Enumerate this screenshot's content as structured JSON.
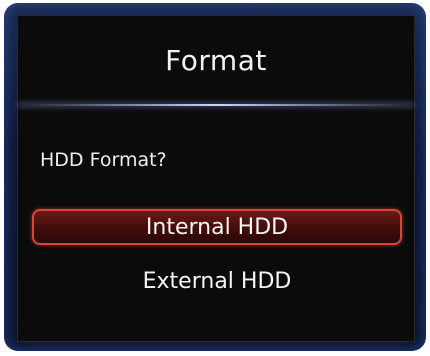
{
  "dialog": {
    "title": "Format",
    "question": "HDD Format?",
    "options": [
      {
        "label": "Internal HDD",
        "selected": true
      },
      {
        "label": "External HDD",
        "selected": false
      }
    ]
  },
  "colors": {
    "frame": "#0d1838",
    "dialog_background": "#0b0b0b",
    "selection_border": "#d8453a",
    "selection_fill": "#4a110e",
    "text": "#f2f2f2"
  }
}
